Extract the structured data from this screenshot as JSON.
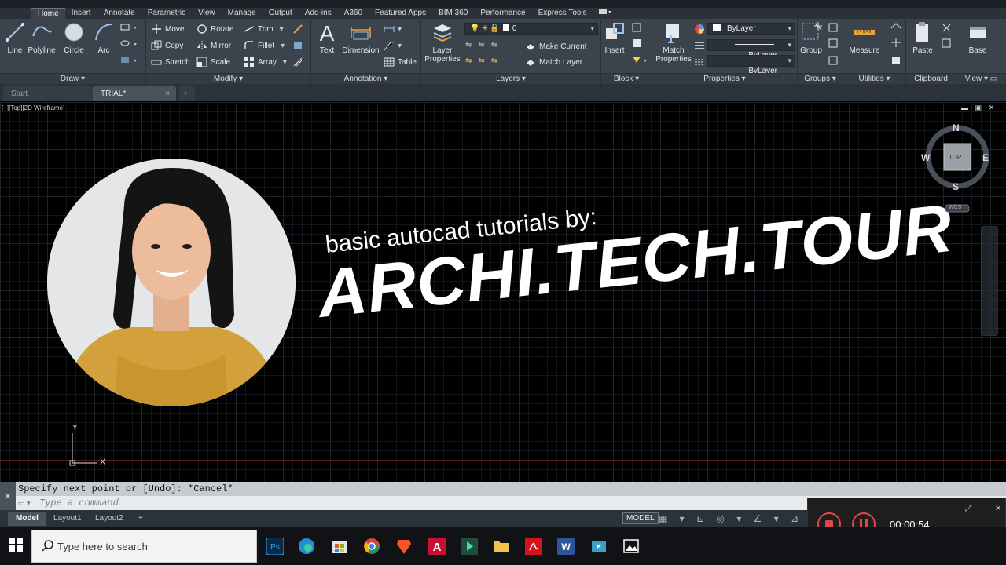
{
  "ribbon_tabs": [
    "Home",
    "Insert",
    "Annotate",
    "Parametric",
    "View",
    "Manage",
    "Output",
    "Add-ins",
    "A360",
    "Featured Apps",
    "BIM 360",
    "Performance",
    "Express Tools"
  ],
  "panels": {
    "draw": {
      "title": "Draw",
      "line": "Line",
      "polyline": "Polyline",
      "circle": "Circle",
      "arc": "Arc"
    },
    "modify": {
      "title": "Modify",
      "move": "Move",
      "rotate": "Rotate",
      "trim": "Trim",
      "copy": "Copy",
      "mirror": "Mirror",
      "fillet": "Fillet",
      "stretch": "Stretch",
      "scale": "Scale",
      "array": "Array"
    },
    "annotation": {
      "title": "Annotation",
      "text": "Text",
      "dimension": "Dimension",
      "table": "Table"
    },
    "layers": {
      "title": "Layers",
      "layer_properties": "Layer Properties",
      "layer_value": "0",
      "make_current": "Make Current",
      "match_layer": "Match Layer"
    },
    "block": {
      "title": "Block",
      "insert": "Insert"
    },
    "properties": {
      "title": "Properties",
      "match_properties": "Match Properties",
      "color": "ByLayer",
      "linetype": "ByLayer",
      "lineweight": "ByLayer"
    },
    "groups": {
      "title": "Groups",
      "group": "Group"
    },
    "utilities": {
      "title": "Utilities",
      "measure": "Measure"
    },
    "clipboard": {
      "title": "Clipboard",
      "paste": "Paste"
    },
    "view": {
      "title": "View",
      "base": "Base"
    }
  },
  "file_tabs": {
    "start": "Start",
    "trial": "TRIAL*"
  },
  "viewport_label": "[−][Top][2D Wireframe]",
  "viewcube": {
    "n": "N",
    "s": "S",
    "e": "E",
    "w": "W",
    "top": "TOP",
    "wcs": "WCS"
  },
  "ucs": {
    "x": "X",
    "y": "Y"
  },
  "overlay": {
    "tagline": "basic autocad tutorials by:",
    "brand": "ARCHI.TECH.TOUR"
  },
  "command": {
    "history": "Specify next point or [Undo]: *Cancel*",
    "placeholder": "Type a command"
  },
  "layout_tabs": {
    "model": "Model",
    "layout1": "Layout1",
    "layout2": "Layout2"
  },
  "status": {
    "model_button": "MODEL"
  },
  "recorder": {
    "time": "00:00:54"
  },
  "taskbar": {
    "search_placeholder": "Type here to search"
  },
  "colors": {
    "ribbon": "#3b434c",
    "canvas": "#000000",
    "accent": "#e04848"
  }
}
